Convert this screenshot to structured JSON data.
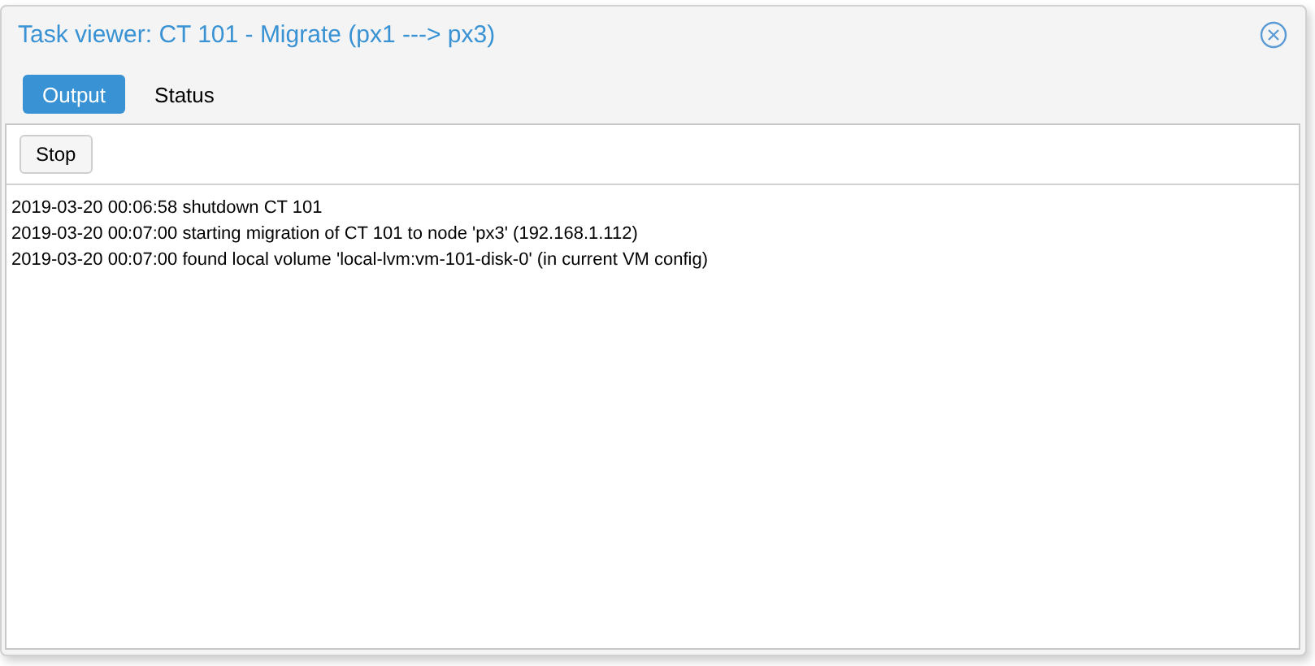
{
  "window": {
    "title": "Task viewer: CT 101 - Migrate (px1 ---> px3)"
  },
  "tabs": [
    {
      "label": "Output",
      "selected": true
    },
    {
      "label": "Status",
      "selected": false
    }
  ],
  "toolbar": {
    "buttons": [
      "Stop"
    ]
  },
  "log": [
    "2019-03-20 00:06:58 shutdown CT 101",
    "2019-03-20 00:07:00 starting migration of CT 101 to node 'px3' (192.168.1.112)",
    "2019-03-20 00:07:00 found local volume 'local-lvm:vm-101-disk-0' (in current VM config)"
  ]
}
